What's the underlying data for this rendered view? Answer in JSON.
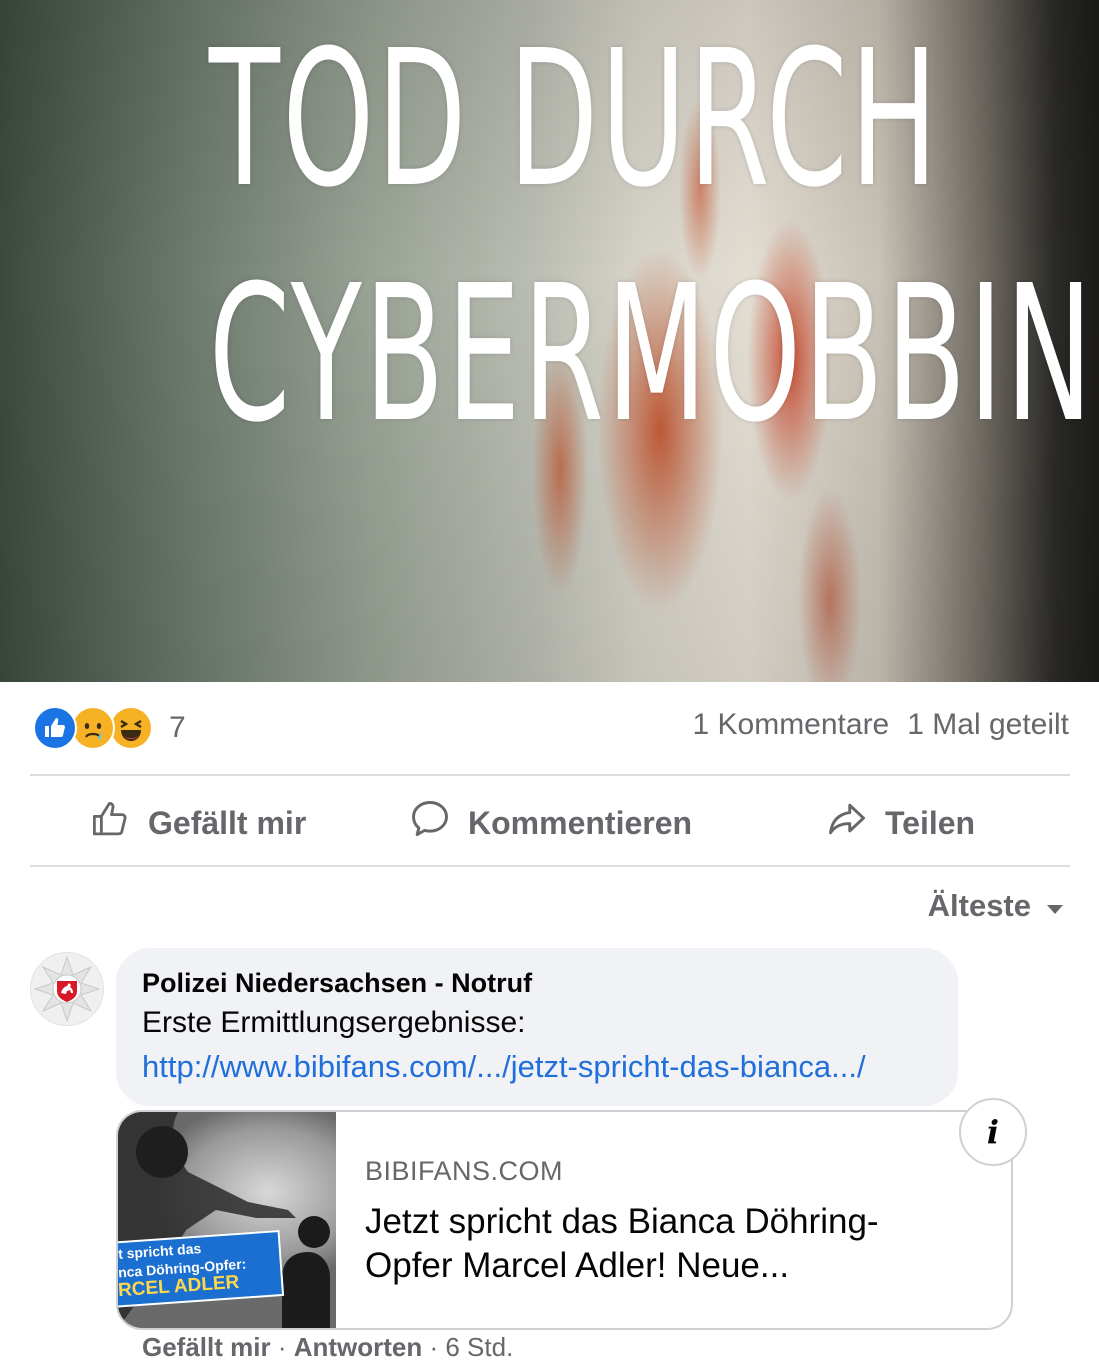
{
  "hero": {
    "line1": "TOD DURCH",
    "line2": "CYBERMOBBING"
  },
  "reactions": {
    "icons": [
      "like-icon",
      "sad-icon",
      "haha-icon"
    ],
    "count": "7",
    "comments": "1 Kommentare",
    "shares": "1 Mal geteilt"
  },
  "actions": {
    "like": "Gefällt mir",
    "comment": "Kommentieren",
    "share": "Teilen"
  },
  "sort": {
    "label": "Älteste"
  },
  "comment": {
    "author": "Polizei Niedersachsen - Notruf",
    "text": "Erste Ermittlungsergebnisse:",
    "link": "http://www.bibifans.com/.../jetzt-spricht-das-bianca.../",
    "preview": {
      "domain": "BIBIFANS.COM",
      "title": "Jetzt spricht das Bianca Döhring-Opfer Marcel Adler! Neue...",
      "thumb_line1": "t spricht das",
      "thumb_line2": "nca Döhring-Opfer:",
      "thumb_line3": "RCEL ADLER"
    },
    "meta": {
      "like": "Gefällt mir",
      "sep1": " · ",
      "reply": "Antworten",
      "sep2": " · ",
      "time": "6 Std."
    }
  },
  "colors": {
    "link": "#216fdb",
    "secondary_text": "#65676b",
    "bubble_bg": "#f0f2f5",
    "like_blue": "#1b74e4"
  }
}
